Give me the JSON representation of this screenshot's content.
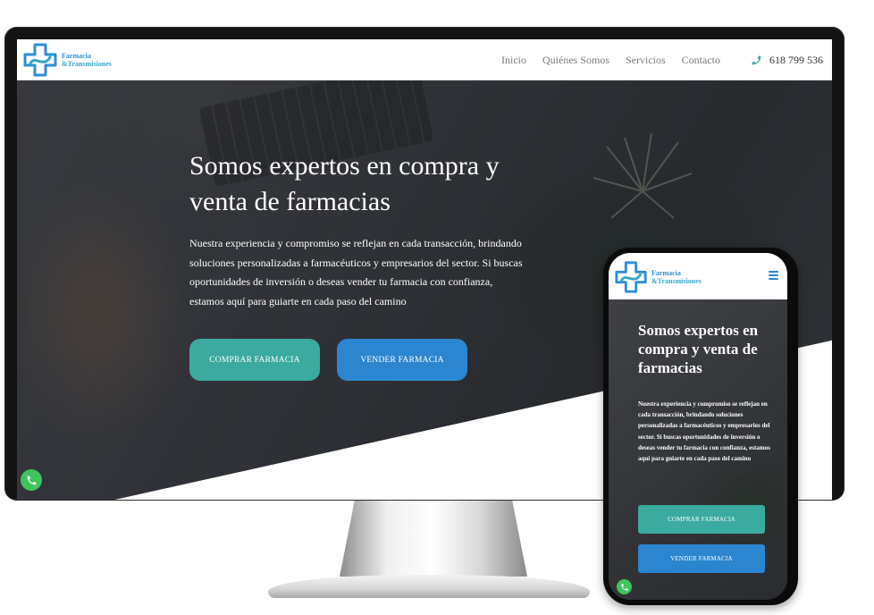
{
  "brand": {
    "name_line1": "Farmacia",
    "name_line2": "&Transmisiones"
  },
  "desktop": {
    "nav": {
      "links": [
        "Inicio",
        "Quiénes Somos",
        "Servicios",
        "Contacto"
      ],
      "phone": "618 799 536"
    },
    "hero": {
      "title": "Somos expertos en compra y venta de farmacias",
      "description": "Nuestra experiencia y compromiso se reflejan en cada transacción, brindando soluciones personalizadas a farmacéuticos y empresarios del sector. Si buscas oportunidades de inversión o deseas vender tu farmacia con confianza, estamos aquí para guiarte en cada paso del camino",
      "buy_button": "COMPRAR FARMACIA",
      "sell_button": "VENDER FARMACIA"
    }
  },
  "mobile": {
    "hero": {
      "title": "Somos expertos en compra y venta de farmacias",
      "description": "Nuestra experiencia y compromiso se reflejan en cada transacción, brindando soluciones personalizadas a farmacéuticos y empresarios del sector. Si buscas oportunidades de inversión o deseas vender tu farmacia con confianza, estamos aquí para guiarte en cada paso del camino",
      "buy_button": "COMPRAR FARMACIA",
      "sell_button": "VENDER FARMACIA"
    }
  },
  "icons": {
    "logo": "pharmacy-cross-logo-icon",
    "phone": "phone-icon",
    "whatsapp": "whatsapp-icon",
    "menu": "hamburger-menu-icon"
  },
  "colors": {
    "teal_button": "#3aab9e",
    "blue_button": "#2b86cf",
    "brand_blue": "#2b8fd4",
    "whatsapp_green": "#3fc35d"
  }
}
